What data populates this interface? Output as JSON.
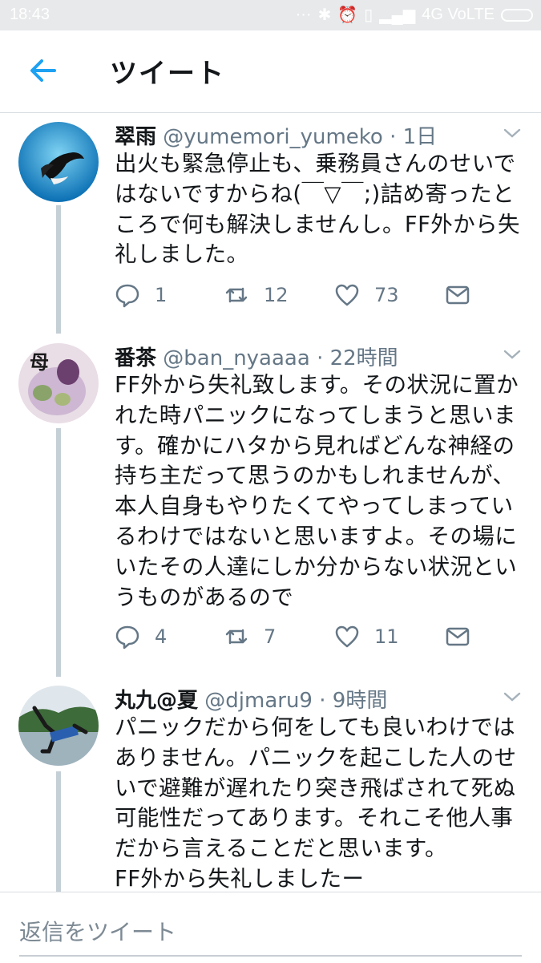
{
  "status_bar": {
    "time": "18:43",
    "network": "4G VoLTE"
  },
  "header": {
    "title": "ツイート",
    "back_icon": "back-arrow-icon"
  },
  "colors": {
    "accent": "#1da1f2",
    "meta": "#657786",
    "thread_line": "#c4cfd6"
  },
  "tweets": [
    {
      "name": "翠雨",
      "handle": "@yumemori_yumeko",
      "time": "1日",
      "lines": [
        "出火も緊急停止も、乗務員さんのせいで",
        "はないですからね(￣▽￣;)詰め寄ったと",
        "ころで何も解決しませんし。FF外から失",
        "礼しました。"
      ],
      "replies": "1",
      "retweets": "12",
      "likes": "73"
    },
    {
      "name": "番茶",
      "handle": "@ban_nyaaaa",
      "time": "22時間",
      "lines": [
        "FF外から失礼致します。その状況に置か",
        "れた時パニックになってしまうと思いま",
        "す。確かにハタから見ればどんな神経の",
        "持ち主だって思うのかもしれませんが、",
        "本人自身もやりたくてやってしまってい",
        "るわけではないと思いますよ。その場に",
        "いたその人達にしか分からない状況とい",
        "うものがあるので"
      ],
      "replies": "4",
      "retweets": "7",
      "likes": "11"
    },
    {
      "name": "丸九@夏",
      "handle": "@djmaru9",
      "time": "9時間",
      "lines": [
        "パニックだから何をしても良いわけでは",
        "ありません。パニックを起こした人のせ",
        "いで避難が遅れたり突き飛ばされて死ぬ",
        "可能性だってあります。それこそ他人事",
        "だから言えることだと思います。",
        "FF外から失礼しましたー"
      ]
    }
  ],
  "reply_bar": {
    "placeholder": "返信をツイート"
  }
}
